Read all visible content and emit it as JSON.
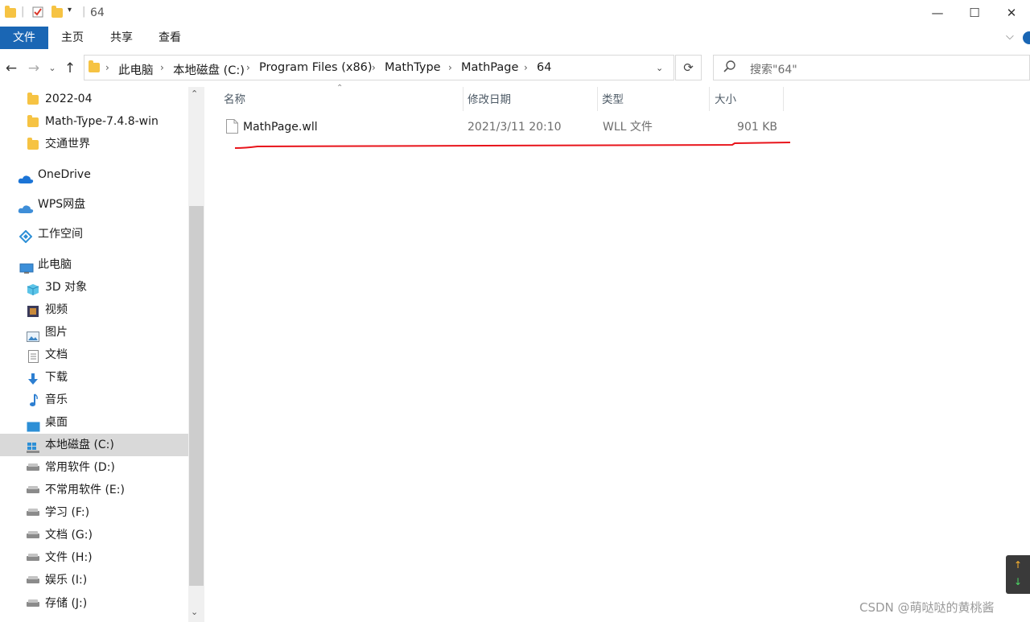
{
  "window": {
    "title": "64"
  },
  "ribbon": {
    "tabs": [
      "文件",
      "主页",
      "共享",
      "查看"
    ]
  },
  "address": {
    "crumbs": [
      "此电脑",
      "本地磁盘 (C:)",
      "Program Files (x86)",
      "MathType",
      "MathPage",
      "64"
    ]
  },
  "search": {
    "placeholder": "搜索\"64\""
  },
  "sidebar": {
    "items": [
      {
        "label": "2022-04",
        "icon": "folder-icon"
      },
      {
        "label": "Math-Type-7.4.8-win",
        "icon": "folder-icon"
      },
      {
        "label": "交通世界",
        "icon": "folder-icon"
      },
      {
        "label": "OneDrive",
        "icon": "cloud-icon"
      },
      {
        "label": "WPS网盘",
        "icon": "cloud-icon"
      },
      {
        "label": "工作空间",
        "icon": "workspace-icon"
      },
      {
        "label": "此电脑",
        "icon": "computer-icon"
      },
      {
        "label": "3D 对象",
        "icon": "cube-icon"
      },
      {
        "label": "视频",
        "icon": "video-icon"
      },
      {
        "label": "图片",
        "icon": "picture-icon"
      },
      {
        "label": "文档",
        "icon": "document-icon"
      },
      {
        "label": "下载",
        "icon": "download-icon"
      },
      {
        "label": "音乐",
        "icon": "music-icon"
      },
      {
        "label": "桌面",
        "icon": "desktop-icon"
      },
      {
        "label": "本地磁盘 (C:)",
        "icon": "windows-drive-icon"
      },
      {
        "label": "常用软件 (D:)",
        "icon": "drive-icon"
      },
      {
        "label": "不常用软件 (E:)",
        "icon": "drive-icon"
      },
      {
        "label": "学习 (F:)",
        "icon": "drive-icon"
      },
      {
        "label": "文档 (G:)",
        "icon": "drive-icon"
      },
      {
        "label": "文件 (H:)",
        "icon": "drive-icon"
      },
      {
        "label": "娱乐 (I:)",
        "icon": "drive-icon"
      },
      {
        "label": "存储 (J:)",
        "icon": "drive-icon"
      }
    ]
  },
  "columns": {
    "name": "名称",
    "modified": "修改日期",
    "type": "类型",
    "size": "大小"
  },
  "files": [
    {
      "name": "MathPage.wll",
      "modified": "2021/3/11 20:10",
      "type": "WLL 文件",
      "size": "901 KB"
    }
  ],
  "watermark": "CSDN @萌哒哒的黄桃酱",
  "colors": {
    "accent": "#1a66b4",
    "annotation": "#e8141b"
  }
}
